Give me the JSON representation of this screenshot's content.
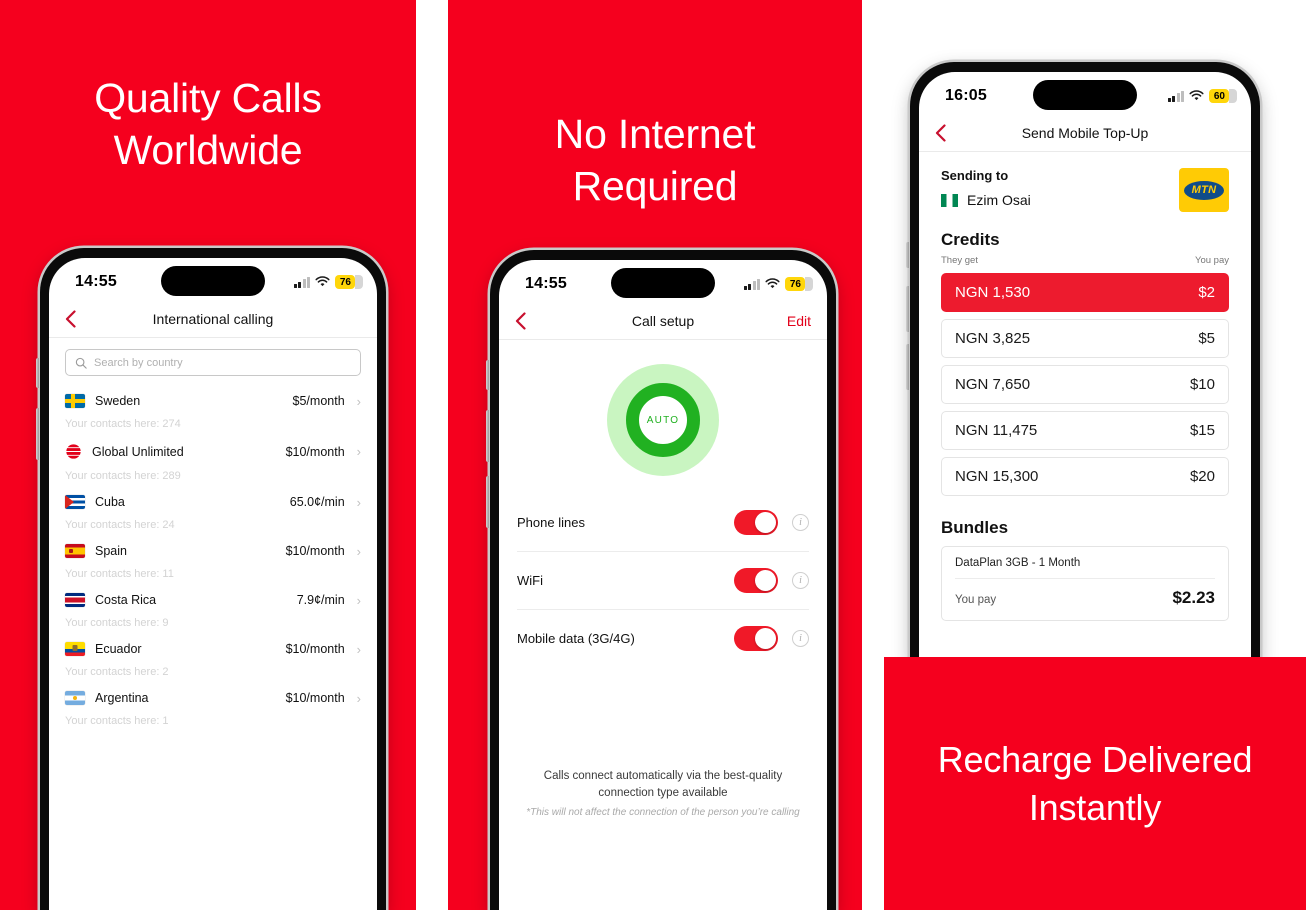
{
  "theme": {
    "brand_red": "#F5001E",
    "accent_red": "#ED1B2E",
    "green": "#21B121",
    "battery_yellow": "#FFD60A"
  },
  "panels": {
    "panel1": {
      "headline_line1": "Quality Calls",
      "headline_line2": "Worldwide",
      "phone": {
        "status": {
          "time": "14:55",
          "battery": "76"
        },
        "nav": {
          "title": "International calling"
        },
        "search": {
          "placeholder": "Search by country"
        },
        "rows": [
          {
            "flag": "se",
            "name": "Sweden",
            "price": "$5/month",
            "sub": "Your contacts here: 274"
          },
          {
            "flag": "globe",
            "name": "Global Unlimited",
            "price": "$10/month",
            "sub": "Your contacts here: 289"
          },
          {
            "flag": "cu",
            "name": "Cuba",
            "price": "65.0¢/min",
            "sub": "Your contacts here: 24"
          },
          {
            "flag": "es",
            "name": "Spain",
            "price": "$10/month",
            "sub": "Your contacts here: 11"
          },
          {
            "flag": "cr",
            "name": "Costa Rica",
            "price": "7.9¢/min",
            "sub": "Your contacts here: 9"
          },
          {
            "flag": "ec",
            "name": "Ecuador",
            "price": "$10/month",
            "sub": "Your contacts here: 2"
          },
          {
            "flag": "ar",
            "name": "Argentina",
            "price": "$10/month",
            "sub": "Your contacts here: 1"
          }
        ]
      }
    },
    "panel2": {
      "headline_line1": "No Internet",
      "headline_line2": "Required",
      "phone": {
        "status": {
          "time": "14:55",
          "battery": "76"
        },
        "nav": {
          "title": "Call setup",
          "edit": "Edit"
        },
        "auto_label": "AUTO",
        "toggles": [
          {
            "label": "Phone lines",
            "on": true,
            "info": "i"
          },
          {
            "label": "WiFi",
            "on": true,
            "info": "i"
          },
          {
            "label": "Mobile data (3G/4G)",
            "on": true,
            "info": "i"
          }
        ],
        "footer_main": "Calls connect automatically via the best-quality connection type available",
        "footer_note": "*This will not affect the connection of the person you’re calling"
      }
    },
    "panel3": {
      "headline_line1": "Recharge Delivered",
      "headline_line2": "Instantly",
      "phone": {
        "status": {
          "time": "16:05",
          "battery": "60"
        },
        "nav": {
          "title": "Send Mobile Top-Up"
        },
        "sending_to_label": "Sending to",
        "recipient": "Ezim Osai",
        "carrier": "MTN",
        "credits_title": "Credits",
        "col_they_get": "They get",
        "col_you_pay": "You pay",
        "credits": [
          {
            "get": "NGN 1,530",
            "pay": "$2",
            "selected": true
          },
          {
            "get": "NGN 3,825",
            "pay": "$5",
            "selected": false
          },
          {
            "get": "NGN 7,650",
            "pay": "$10",
            "selected": false
          },
          {
            "get": "NGN 11,475",
            "pay": "$15",
            "selected": false
          },
          {
            "get": "NGN 15,300",
            "pay": "$20",
            "selected": false
          }
        ],
        "bundles_title": "Bundles",
        "bundle": {
          "name": "DataPlan 3GB - 1 Month",
          "pay_label": "You pay",
          "amount": "$2.23"
        }
      }
    }
  }
}
